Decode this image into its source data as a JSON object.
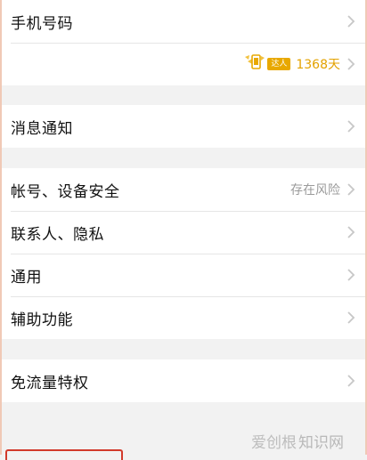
{
  "settings": {
    "phone_label": "手机号码",
    "streak": {
      "badge_text": "达人",
      "days": "1368天"
    },
    "notifications_label": "消息通知",
    "account_security": {
      "label": "帐号、设备安全",
      "status": "存在风险"
    },
    "contacts_privacy_label": "联系人、隐私",
    "general_label": "通用",
    "accessibility_label": "辅助功能",
    "free_data_label": "免流量特权"
  },
  "watermark": {
    "part1": "爱创根",
    "part2": "知识网"
  },
  "colors": {
    "accent_gold": "#e8a800",
    "chevron": "#c7c7c7",
    "highlight_red": "#d23a2b"
  }
}
